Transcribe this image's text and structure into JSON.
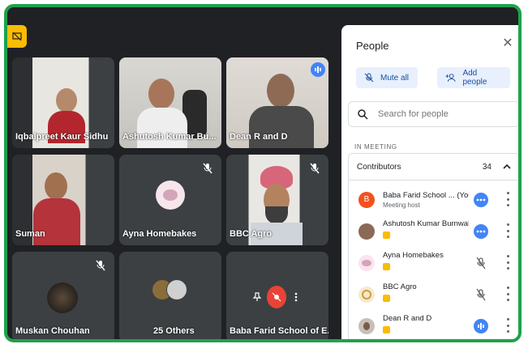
{
  "tiles": [
    {
      "name": "Iqbalpreet Kaur Sidhu"
    },
    {
      "name": "Ashutosh Kumar Bu..."
    },
    {
      "name": "Dean R and D"
    },
    {
      "name": "Suman"
    },
    {
      "name": "Ayna Homebakes"
    },
    {
      "name": "BBC Agro"
    },
    {
      "name": "Muskan Chouhan"
    },
    {
      "name": "25 Others"
    },
    {
      "name": "Baba Farid School of E..."
    }
  ],
  "panel": {
    "title": "People",
    "mute_all": "Mute all",
    "add_people": "Add people",
    "search_placeholder": "Search for people",
    "section": "IN MEETING",
    "group_label": "Contributors",
    "group_count": "34",
    "participants": [
      {
        "name": "Baba Farid School ... (You)",
        "sub": "Meeting host",
        "initial": "B"
      },
      {
        "name": "Ashutosh Kumar Burnwal",
        "sub": ""
      },
      {
        "name": "Ayna Homebakes",
        "sub": ""
      },
      {
        "name": "BBC Agro",
        "sub": ""
      },
      {
        "name": "Dean R and D",
        "sub": ""
      }
    ]
  },
  "colors": {
    "accent": "#1ea24a",
    "blue": "#4285f4",
    "avatar_b": "#f4511e"
  }
}
